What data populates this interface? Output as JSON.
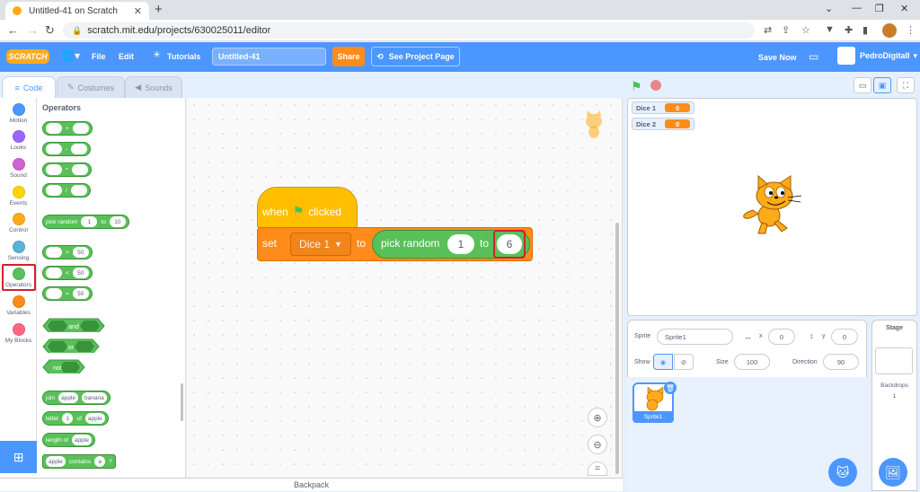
{
  "browser": {
    "tab_title": "Untitled-41 on Scratch",
    "url": "scratch.mit.edu/projects/630025011/editor"
  },
  "menubar": {
    "logo": "SCRATCH",
    "file": "File",
    "edit": "Edit",
    "tutorials": "Tutorials",
    "project_title": "Untitled-41",
    "share": "Share",
    "see_project_page": "See Project Page",
    "save_now": "Save Now",
    "username": "PedroDigitall"
  },
  "editor_tabs": {
    "code": "Code",
    "costumes": "Costumes",
    "sounds": "Sounds"
  },
  "categories": [
    {
      "label": "Motion",
      "color": "#4c97ff"
    },
    {
      "label": "Looks",
      "color": "#9966ff"
    },
    {
      "label": "Sound",
      "color": "#cf63cf"
    },
    {
      "label": "Events",
      "color": "#ffd500"
    },
    {
      "label": "Control",
      "color": "#ffab19"
    },
    {
      "label": "Sensing",
      "color": "#5cb1d6"
    },
    {
      "label": "Operators",
      "color": "#59c059"
    },
    {
      "label": "Variables",
      "color": "#ff8c1a"
    },
    {
      "label": "My Blocks",
      "color": "#ff6680"
    }
  ],
  "palette": {
    "title": "Operators",
    "add": "+",
    "sub": "-",
    "mul": "*",
    "div": "/",
    "pick_random": "pick random",
    "pick_a": "1",
    "pick_to": "to",
    "pick_b": "10",
    "gt": ">",
    "gt_val": "50",
    "lt": "<",
    "lt_val": "50",
    "eq": "=",
    "eq_val": "50",
    "and": "and",
    "or": "or",
    "not": "not",
    "join": "join",
    "join_a": "apple",
    "join_b": "banana",
    "letter": "letter",
    "letter_n": "1",
    "letter_of": "of",
    "letter_word": "apple",
    "length_of": "length of",
    "length_word": "apple",
    "contains_word": "apple",
    "contains": "contains",
    "contains_char": "a",
    "contains_q": "?"
  },
  "script": {
    "when": "when",
    "clicked": "clicked",
    "set": "set",
    "variable": "Dice 1",
    "to": "to",
    "pick_random": "pick random",
    "from": "1",
    "to2": "to",
    "to_value": "6"
  },
  "backpack": "Backpack",
  "monitors": [
    {
      "name": "Dice 1",
      "value": "0"
    },
    {
      "name": "Dice 2",
      "value": "0"
    }
  ],
  "sprite_info": {
    "sprite_label": "Sprite",
    "sprite_name": "Sprite1",
    "x_label": "x",
    "x": "0",
    "y_label": "y",
    "y": "0",
    "show_label": "Show",
    "size_label": "Size",
    "size": "100",
    "direction_label": "Direction",
    "direction": "90"
  },
  "sprites": [
    {
      "name": "Sprite1"
    }
  ],
  "stage_pane": {
    "title": "Stage",
    "backdrops_label": "Backdrops",
    "backdrops_count": "1"
  }
}
